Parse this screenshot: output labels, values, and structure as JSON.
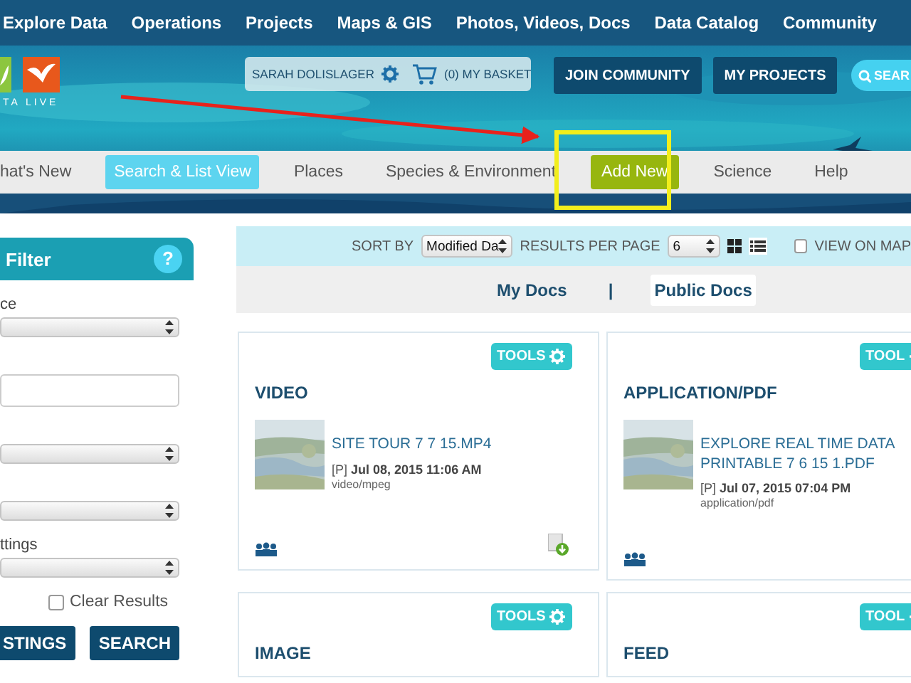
{
  "top_nav": [
    "Explore Data",
    "Operations",
    "Projects",
    "Maps & GIS",
    "Photos, Videos, Docs",
    "Data Catalog",
    "Community"
  ],
  "header": {
    "logo_text": "TA LIVE",
    "user": "SARAH DOLISLAGER",
    "basket": "(0) MY BASKET",
    "buttons": [
      "JOIN COMMUNITY",
      "MY PROJECTS"
    ],
    "search": "SEAR"
  },
  "sub_nav": [
    {
      "label": "hat's New",
      "kind": "link",
      "selected": false
    },
    {
      "label": "Search & List View",
      "kind": "link",
      "selected": true
    },
    {
      "label": "Places",
      "kind": "link",
      "selected": false
    },
    {
      "label": "Species & Environment",
      "kind": "link",
      "selected": false
    },
    {
      "label": "Add New",
      "kind": "button",
      "selected": false
    },
    {
      "label": "Science",
      "kind": "link",
      "selected": false
    },
    {
      "label": "Help",
      "kind": "link",
      "selected": false
    }
  ],
  "filter": {
    "title": "Filter",
    "help": "?",
    "fields": [
      {
        "kind": "select",
        "label": "ce"
      },
      {
        "kind": "input"
      },
      {
        "kind": "select"
      },
      {
        "kind": "select"
      },
      {
        "kind": "select",
        "label": "ttings"
      }
    ],
    "clear_results": {
      "label": "Clear Results",
      "checked": false
    },
    "buttons": [
      "STINGS",
      "SEARCH"
    ]
  },
  "toolbar": {
    "sort_label": "SORT BY",
    "sort_value": "Modified Da",
    "per_page_label": "RESULTS PER PAGE",
    "per_page_value": "6",
    "view_on_map": {
      "label": "VIEW ON MAP",
      "checked": false
    }
  },
  "doc_tabs": [
    {
      "label": "My Docs",
      "selected": false
    },
    {
      "label": "Public Docs",
      "selected": true
    }
  ],
  "doc_tab_separator": "|",
  "cards": [
    {
      "tools": "TOOLS",
      "type": "VIDEO",
      "title": "SITE TOUR 7 7 15.MP4",
      "date": "[P] **Jul 08, 2015 11:06 AM**",
      "mime": "video/mpeg",
      "downloadable": true
    },
    {
      "tools": "TOOL",
      "type": "APPLICATION/PDF",
      "title": "EXPLORE REAL TIME DATA PRINTABLE 7 6 15 1.PDF",
      "date": "[P] **Jul 07, 2015 07:04 PM**",
      "mime": "application/pdf",
      "downloadable": false
    },
    {
      "tools": "TOOLS",
      "type": "IMAGE"
    },
    {
      "tools": "TOOL",
      "type": "FEED"
    }
  ]
}
